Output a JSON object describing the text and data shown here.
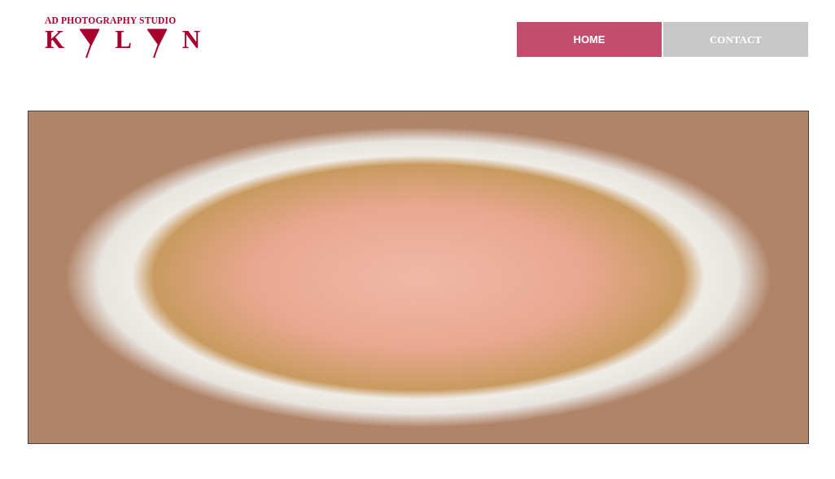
{
  "logo": {
    "tagline": "AD PHOTOGRAPHY STUDIO",
    "letters": [
      {
        "kind": "letter",
        "text": "K"
      },
      {
        "kind": "mark"
      },
      {
        "kind": "letter",
        "text": "L"
      },
      {
        "kind": "mark"
      },
      {
        "kind": "letter",
        "text": "N"
      }
    ]
  },
  "nav": [
    {
      "label": "HOME",
      "selected": true
    },
    {
      "label": "CONTACT",
      "selected": false
    }
  ]
}
